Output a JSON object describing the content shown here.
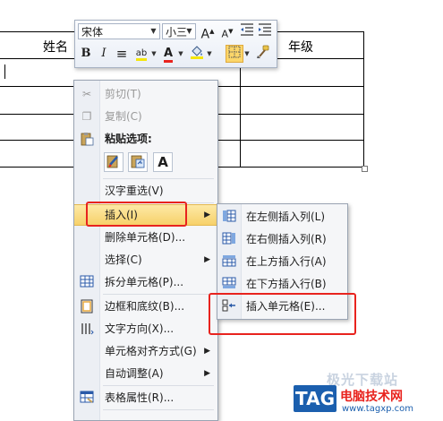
{
  "document": {
    "table": {
      "header_name": "姓名",
      "header_grade": "年级"
    }
  },
  "mini_toolbar": {
    "font_name": "宋体",
    "font_size": "小三",
    "grow_font_glyph": "A",
    "shrink_font_glyph": "A",
    "bold_glyph": "B",
    "italic_glyph": "I",
    "center_glyph": "≡",
    "highlight_glyph": "ab",
    "font_color_glyph": "A",
    "colors": {
      "font_color": "#e8231e",
      "highlight": "#f5e60b",
      "pressed": "#fbd66a"
    }
  },
  "context_menu": {
    "cut": {
      "label": "剪切(T)",
      "enabled": false
    },
    "copy": {
      "label": "复制(C)",
      "enabled": false
    },
    "paste_title": "粘贴选项:",
    "paste_options": [
      "keep-source-formatting-icon",
      "merge-formatting-icon",
      "keep-text-only-icon"
    ],
    "paste_text_only_glyph": "A",
    "reconvert": "汉字重选(V)",
    "insert": "插入(I)",
    "delete_cells": "删除单元格(D)...",
    "select": "选择(C)",
    "split_cells": "拆分单元格(P)...",
    "borders_shading": "边框和底纹(B)...",
    "text_direction": "文字方向(X)...",
    "cell_alignment": "单元格对齐方式(G)",
    "autofit": "自动调整(A)",
    "table_properties": "表格属性(R)..."
  },
  "insert_submenu": {
    "items": [
      "在左侧插入列(L)",
      "在右侧插入列(R)",
      "在上方插入行(A)",
      "在下方插入行(B)",
      "插入单元格(E)..."
    ]
  },
  "watermark": {
    "faint_text": "极光下载站",
    "tag": "TAG",
    "site": "电脑技术网",
    "url": "www.tagxp.com",
    "colors": {
      "tag_bg": "#1b5fae",
      "site": "#e8231e"
    }
  },
  "annotation_color": "#e8231e"
}
